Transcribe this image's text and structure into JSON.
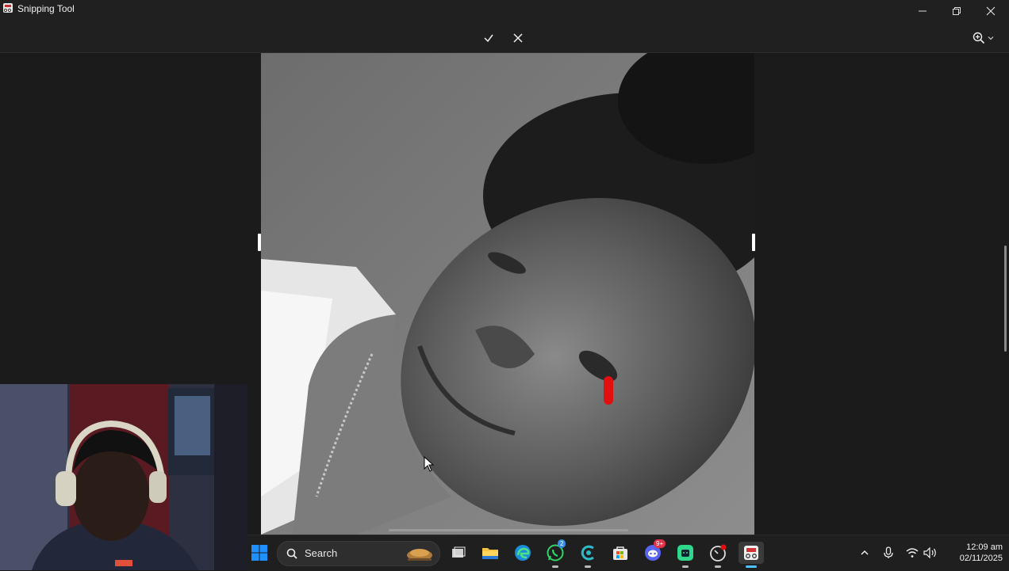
{
  "window": {
    "title": "Snipping Tool"
  },
  "toolbar": {
    "confirm_icon": "checkmark-icon",
    "discard_icon": "close-icon",
    "zoom_icon": "zoom-in-icon"
  },
  "taskbar": {
    "search_label": "Search",
    "whatsapp_badge": "2",
    "discord_badge": "9+",
    "clock_time": "12:09 am",
    "clock_date": "02/11/2025"
  },
  "colors": {
    "accent_red": "#e01010",
    "windows_blue": "#1e90ff"
  }
}
